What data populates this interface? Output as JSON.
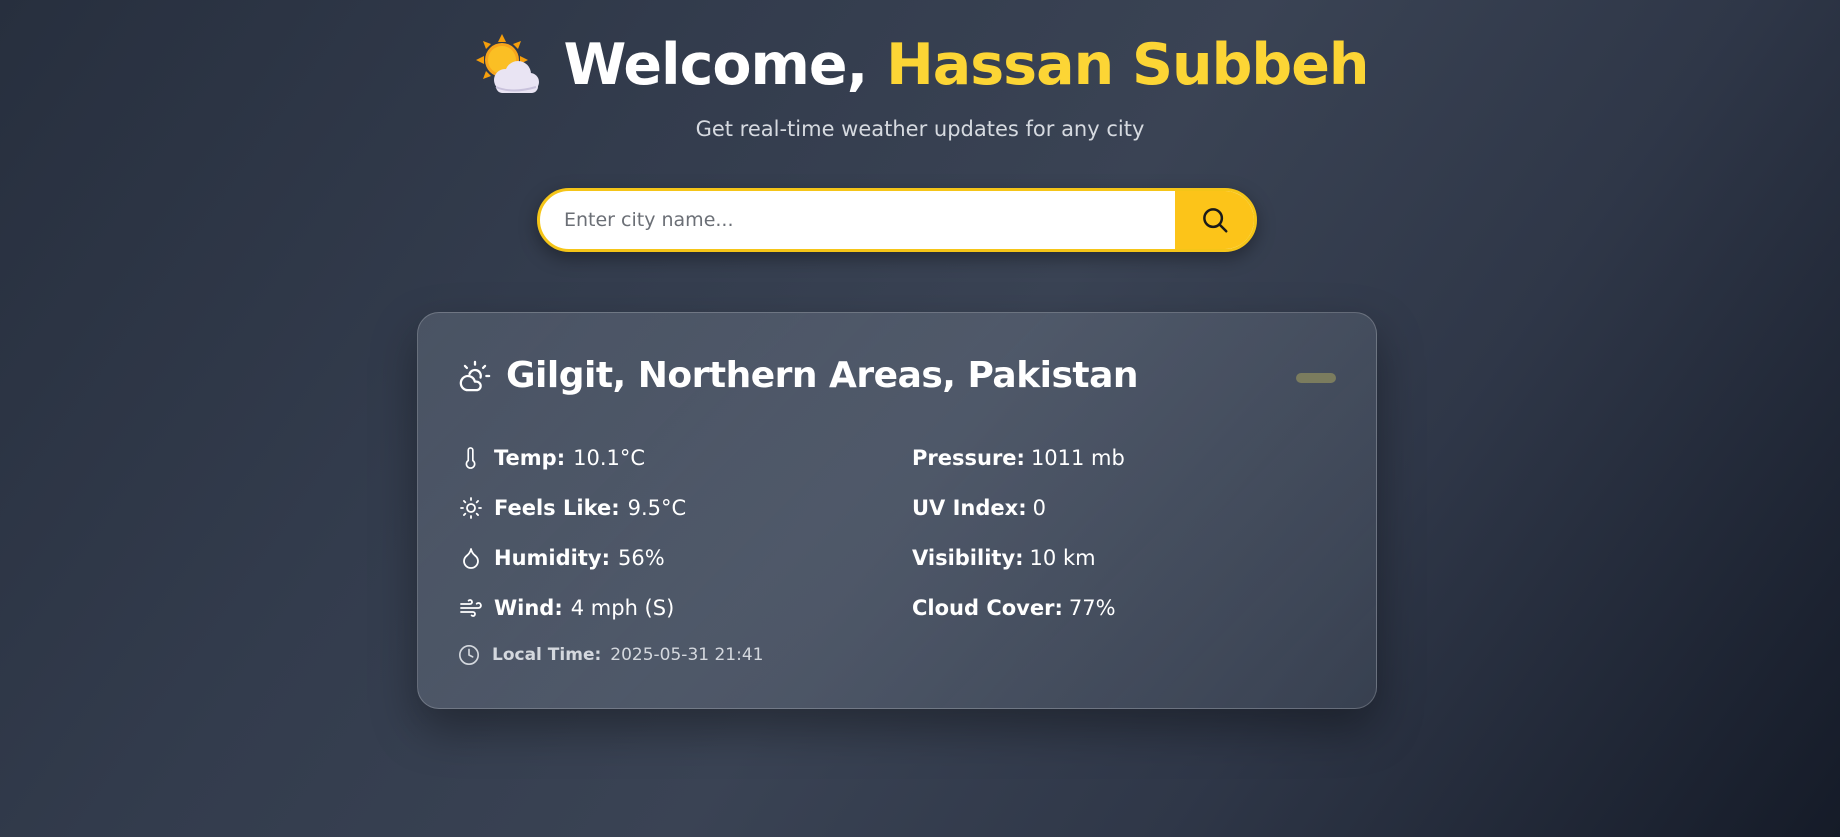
{
  "header": {
    "icon": "sun-behind-cloud-icon",
    "welcome": "Welcome, ",
    "user_name": "Hassan Subbeh",
    "subtitle": "Get real-time weather updates for any city"
  },
  "search": {
    "placeholder": "Enter city name...",
    "value": "",
    "button_icon": "search-icon"
  },
  "weather": {
    "condition_icon": "partly-cloudy-icon",
    "location": "Gilgit, Northern Areas, Pakistan",
    "left": [
      {
        "icon": "thermometer-icon",
        "label": "Temp:",
        "value": "10.1°C"
      },
      {
        "icon": "sun-icon",
        "label": "Feels Like:",
        "value": "9.5°C"
      },
      {
        "icon": "droplet-icon",
        "label": "Humidity:",
        "value": "56%"
      },
      {
        "icon": "wind-icon",
        "label": "Wind:",
        "value": "4 mph (S)"
      }
    ],
    "right": [
      {
        "label": "Pressure:",
        "value": "1011 mb"
      },
      {
        "label": "UV Index:",
        "value": "0"
      },
      {
        "label": "Visibility:",
        "value": "10 km"
      },
      {
        "label": "Cloud Cover:",
        "value": "77%"
      }
    ],
    "local_time_label": "Local Time:",
    "local_time_value": "2025-05-31 21:41"
  },
  "colors": {
    "accent": "#fcd535",
    "search_border": "#f5c518",
    "search_button": "#fcc419"
  }
}
